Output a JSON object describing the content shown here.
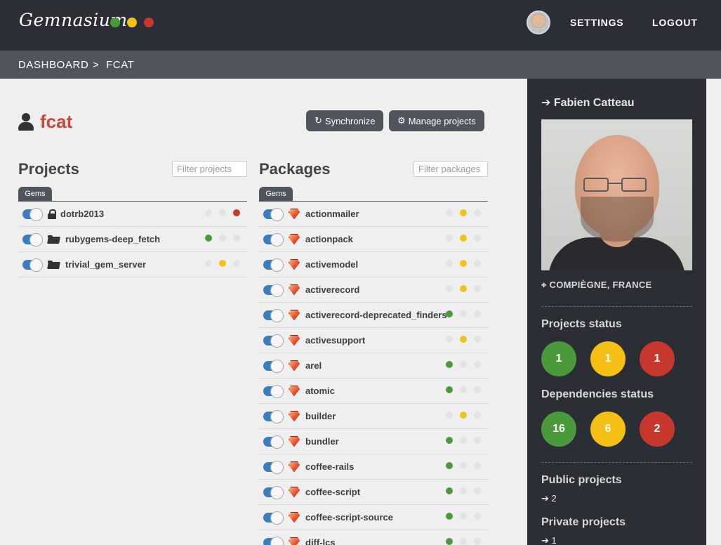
{
  "app": {
    "logo": "Gemnasium",
    "logo_dots": [
      "#4a9a3c",
      "#f5c015",
      "#c6382b"
    ]
  },
  "nav": {
    "settings": "SETTINGS",
    "logout": "LOGOUT"
  },
  "breadcrumb": {
    "home": "DASHBOARD",
    "separator": ">",
    "current": "FCAT"
  },
  "user": {
    "username": "fcat",
    "full_name": "Fabien Catteau",
    "location": "COMPIÈGNE, FRANCE"
  },
  "actions": {
    "synchronize": "Synchronize",
    "manage_projects": "Manage projects"
  },
  "projects": {
    "title": "Projects",
    "filter_placeholder": "Filter projects",
    "tab": "Gems",
    "items": [
      {
        "name": "dotrb2013",
        "icon": "lock-icon",
        "status": [
          "none",
          "none",
          "red"
        ]
      },
      {
        "name": "rubygems-deep_fetch",
        "icon": "folder-open-icon",
        "status": [
          "green",
          "none",
          "none"
        ]
      },
      {
        "name": "trivial_gem_server",
        "icon": "folder-open-icon",
        "status": [
          "none",
          "yellow",
          "none"
        ]
      }
    ]
  },
  "packages": {
    "title": "Packages",
    "filter_placeholder": "Filter packages",
    "tab": "Gems",
    "items": [
      {
        "name": "actionmailer",
        "status": [
          "none",
          "yellow",
          "none"
        ]
      },
      {
        "name": "actionpack",
        "status": [
          "none",
          "yellow",
          "none"
        ]
      },
      {
        "name": "activemodel",
        "status": [
          "none",
          "yellow",
          "none"
        ]
      },
      {
        "name": "activerecord",
        "status": [
          "none",
          "yellow",
          "none"
        ]
      },
      {
        "name": "activerecord-deprecated_finders",
        "status": [
          "green",
          "none",
          "none"
        ]
      },
      {
        "name": "activesupport",
        "status": [
          "none",
          "yellow",
          "none"
        ]
      },
      {
        "name": "arel",
        "status": [
          "green",
          "none",
          "none"
        ]
      },
      {
        "name": "atomic",
        "status": [
          "green",
          "none",
          "none"
        ]
      },
      {
        "name": "builder",
        "status": [
          "none",
          "yellow",
          "none"
        ]
      },
      {
        "name": "bundler",
        "status": [
          "green",
          "none",
          "none"
        ]
      },
      {
        "name": "coffee-rails",
        "status": [
          "green",
          "none",
          "none"
        ]
      },
      {
        "name": "coffee-script",
        "status": [
          "green",
          "none",
          "none"
        ]
      },
      {
        "name": "coffee-script-source",
        "status": [
          "green",
          "none",
          "none"
        ]
      },
      {
        "name": "diff-lcs",
        "status": [
          "green",
          "none",
          "none"
        ]
      }
    ]
  },
  "sidebar": {
    "projects_status_title": "Projects status",
    "projects_status": [
      {
        "value": "1",
        "color": "#4a9a3c"
      },
      {
        "value": "1",
        "color": "#f5c015"
      },
      {
        "value": "1",
        "color": "#c6382b"
      }
    ],
    "dependencies_status_title": "Dependencies status",
    "dependencies_status": [
      {
        "value": "16",
        "color": "#4a9a3c"
      },
      {
        "value": "6",
        "color": "#f5c015"
      },
      {
        "value": "2",
        "color": "#c6382b"
      }
    ],
    "public_projects_title": "Public projects",
    "public_projects_count": "2",
    "private_projects_title": "Private projects",
    "private_projects_count": "1"
  }
}
